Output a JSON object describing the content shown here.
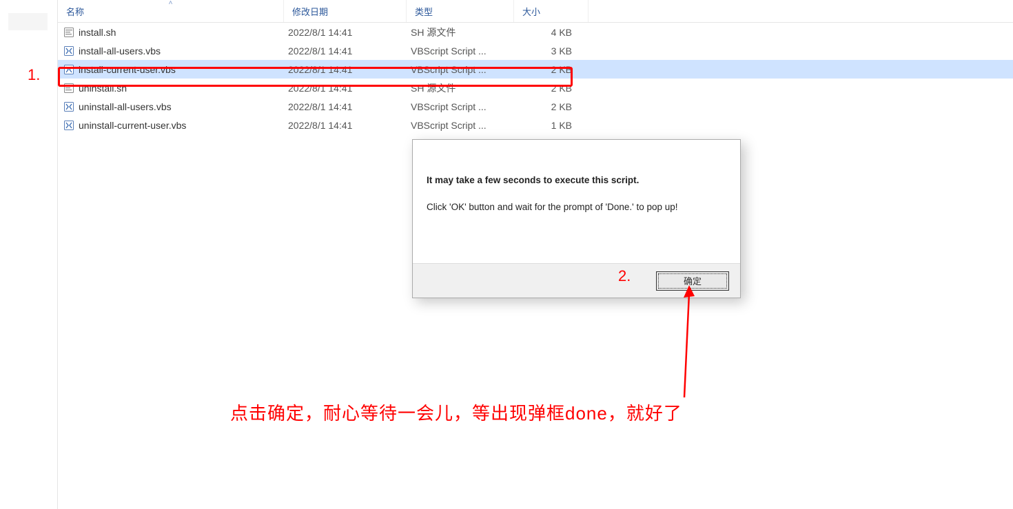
{
  "columns": {
    "name": "名称",
    "date": "修改日期",
    "type": "类型",
    "size": "大小"
  },
  "files": [
    {
      "name": "install.sh",
      "date": "2022/8/1 14:41",
      "type": "SH 源文件",
      "size": "4 KB",
      "icon": "sh",
      "selected": false
    },
    {
      "name": "install-all-users.vbs",
      "date": "2022/8/1 14:41",
      "type": "VBScript Script ...",
      "size": "3 KB",
      "icon": "vbs",
      "selected": false
    },
    {
      "name": "install-current-user.vbs",
      "date": "2022/8/1 14:41",
      "type": "VBScript Script ...",
      "size": "2 KB",
      "icon": "vbs",
      "selected": true
    },
    {
      "name": "uninstall.sh",
      "date": "2022/8/1 14:41",
      "type": "SH 源文件",
      "size": "2 KB",
      "icon": "sh",
      "selected": false
    },
    {
      "name": "uninstall-all-users.vbs",
      "date": "2022/8/1 14:41",
      "type": "VBScript Script ...",
      "size": "2 KB",
      "icon": "vbs",
      "selected": false
    },
    {
      "name": "uninstall-current-user.vbs",
      "date": "2022/8/1 14:41",
      "type": "VBScript Script ...",
      "size": "1 KB",
      "icon": "vbs",
      "selected": false
    }
  ],
  "dialog": {
    "line1": "It may take a few seconds to execute this script.",
    "line2": "Click 'OK' button and wait for the prompt of 'Done.' to pop up!",
    "ok_label": "确定"
  },
  "annotations": {
    "step1": "1.",
    "step2": "2.",
    "caption": "点击确定，耐心等待一会儿，等出现弹框done，就好了"
  }
}
